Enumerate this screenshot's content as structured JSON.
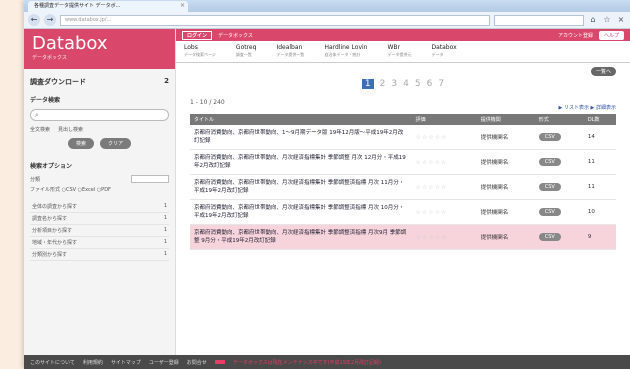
{
  "browser": {
    "tab_title": "各種調査データ提供サイト データボ...",
    "tab_close": "×",
    "url": "www.databox.jp/...",
    "back_icon": "←",
    "forward_icon": "→",
    "close_icon": "×"
  },
  "logo": {
    "title": "Databox",
    "subtitle": "データボックス"
  },
  "sidebar": {
    "download_heading": "調査ダウンロード",
    "download_count": "2",
    "search_heading": "データ検索",
    "search_icon": "⌕",
    "radio": [
      "全文検索",
      "見出し検索"
    ],
    "buttons": [
      "検索",
      "クリア"
    ],
    "options_heading": "検索オプション",
    "option_label": "分類",
    "filter_label": "ファイル形式 ○CSV ○Excel ○PDF",
    "links": [
      {
        "label": "全体の調査から探す",
        "count": "1"
      },
      {
        "label": "調査名から探す",
        "count": "1"
      },
      {
        "label": "分析項目から探す",
        "count": "1"
      },
      {
        "label": "地域・年代から探す",
        "count": "1"
      },
      {
        "label": "分類別から探す",
        "count": "1"
      }
    ]
  },
  "pinkbar": {
    "badge": "ログイン",
    "text": "データボックス",
    "cta": "アカウント登録",
    "cta2": "ヘルプ"
  },
  "topnav": [
    {
      "label": "Lobs",
      "sub": "データ検索ページ"
    },
    {
      "label": "Gotreq",
      "sub": "調査一覧"
    },
    {
      "label": "Idealban",
      "sub": "データ提供一覧"
    },
    {
      "label": "Hardline Lovin",
      "sub": "自治体データ・統計"
    },
    {
      "label": "WBr",
      "sub": "データ提供元"
    },
    {
      "label": "Databox",
      "sub": "データ"
    }
  ],
  "content": {
    "back_label": "一覧へ",
    "pages": [
      "1",
      "2",
      "3",
      "4",
      "5",
      "6",
      "7"
    ],
    "count_text": "1 - 10 / 240",
    "view_link": "▶ リスト表示 ▶ 詳細表示",
    "columns": [
      "タイトル",
      "評価",
      "提供機関",
      "形式",
      "DL数"
    ],
    "rows": [
      {
        "title": "京都府消費動向、京都府世帯動向、1～9月期データ版 19年12月版～平成19年2月改訂記録",
        "stars": "☆☆☆☆☆",
        "org": "提供機関名",
        "action": "CSV",
        "num": "14",
        "highlight": false
      },
      {
        "title": "京都府消費動向、京都府世帯動向、月次経済指標集計 季節調整 月次 12月分・平成19年2月改訂記録",
        "stars": "☆☆☆☆☆",
        "org": "提供機関名",
        "action": "CSV",
        "num": "11",
        "highlight": false
      },
      {
        "title": "京都府消費動向、京都府世帯動向、月次経済指標集計 季節調整済指標 月次 11月分・平成19年2月改訂記録",
        "stars": "☆☆☆☆☆",
        "org": "提供機関名",
        "action": "CSV",
        "num": "11",
        "highlight": false
      },
      {
        "title": "京都府消費動向、京都府世帯動向、月次経済指標集計 季節調整済指標 月次 10月分・平成19年2月改訂記録",
        "stars": "☆☆☆☆☆",
        "org": "提供機関名",
        "action": "CSV",
        "num": "10",
        "highlight": false
      },
      {
        "title": "京都府消費動向、京都府世帯動向、月次経済指標集計 季節調整済指標 月次9月 季節調整 9月分・平成19年2月改訂記録",
        "stars": "☆☆☆☆☆",
        "org": "提供機関名",
        "action": "CSV",
        "num": "9",
        "highlight": true
      }
    ]
  },
  "footer": {
    "links": [
      "このサイトについて",
      "利用規約",
      "サイトマップ",
      "ユーザー登録",
      "お問合せ"
    ],
    "alert": "データボックスは現在メンテナンス中です(平成19年2月改訂記録)"
  }
}
